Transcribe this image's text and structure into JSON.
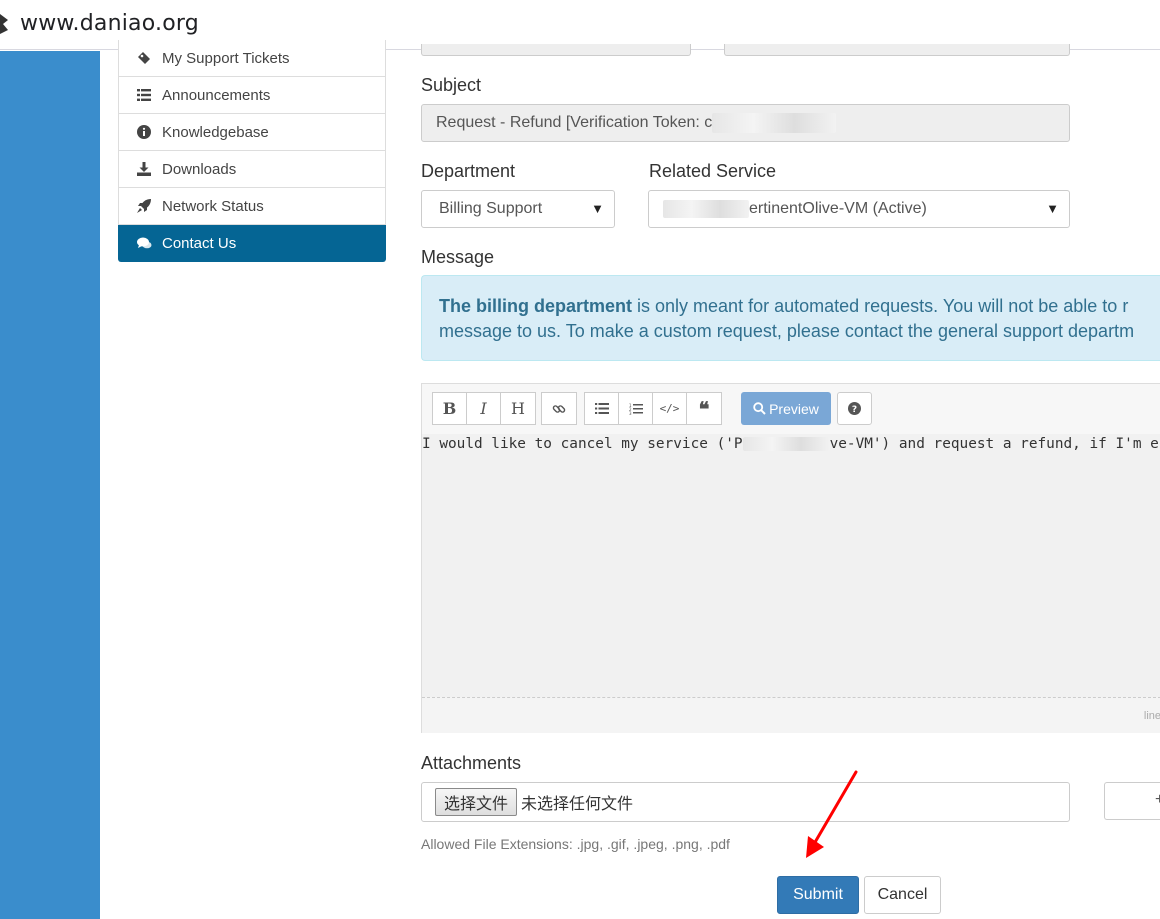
{
  "browser": {
    "url": "www.daniao.org"
  },
  "sidebar": {
    "items": [
      {
        "label": "My Support Tickets",
        "icon": "ticket-icon"
      },
      {
        "label": "Announcements",
        "icon": "list-icon"
      },
      {
        "label": "Knowledgebase",
        "icon": "info-icon"
      },
      {
        "label": "Downloads",
        "icon": "download-icon"
      },
      {
        "label": "Network Status",
        "icon": "rocket-icon"
      },
      {
        "label": "Contact Us",
        "icon": "comments-icon",
        "active": true
      }
    ]
  },
  "form": {
    "subject_label": "Subject",
    "subject_value": "Request - Refund [Verification Token: c",
    "department_label": "Department",
    "department_value": "Billing Support",
    "related_service_label": "Related Service",
    "related_service_value": "ertinentOlive-VM (Active)",
    "message_label": "Message",
    "info_bold": "The billing department",
    "info_line1_rest": " is only meant for automated requests. You will not be able to r",
    "info_line2": "message to us. To make a custom request, please contact the general support departm",
    "message_text_prefix": "I would like to cancel my service ('P",
    "message_text_suffix": "ve-VM') and request a refund, if I'm e",
    "editor_footer": "line",
    "toolbar": {
      "preview_label": "Preview"
    },
    "attachments_label": "Attachments",
    "file_button": "选择文件",
    "file_status": "未选择任何文件",
    "allowed_extensions": "Allowed File Extensions: .jpg, .gif, .jpeg, .png, .pdf",
    "submit_label": "Submit",
    "cancel_label": "Cancel"
  },
  "colors": {
    "sidebar_active": "#056594",
    "submit_button": "#337ab7",
    "info_bg": "#d9edf7",
    "left_band": "#3a8dcc",
    "annotation_arrow": "#ff0000"
  }
}
